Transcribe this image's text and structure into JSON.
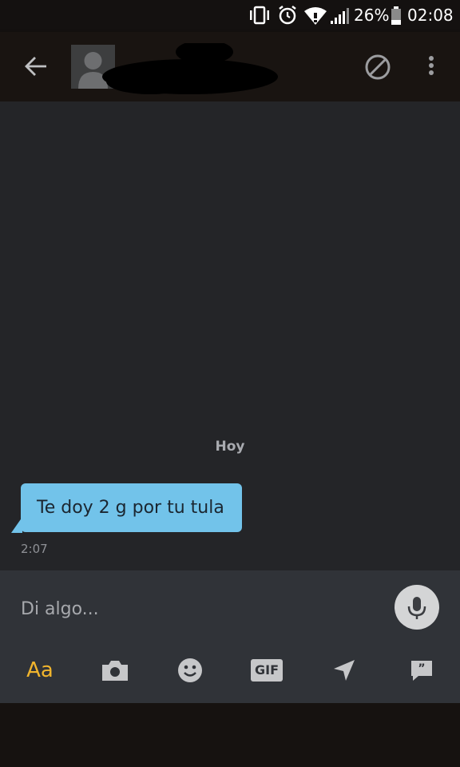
{
  "status_bar": {
    "battery_percent": "26%",
    "time": "02:08",
    "icons": [
      "vibrate-icon",
      "alarm-icon",
      "wifi-icon",
      "signal-icon",
      "battery-icon"
    ]
  },
  "app_bar": {
    "icons": [
      "back-arrow-icon",
      "avatar-placeholder-icon",
      "block-icon",
      "more-vert-icon"
    ]
  },
  "chat": {
    "day_label": "Hoy",
    "messages": [
      {
        "text": "Te doy 2 g por tu tula",
        "time": "2:07"
      }
    ]
  },
  "composer": {
    "placeholder": "Di algo...",
    "mic_icon": "microphone-icon",
    "tools": [
      {
        "name": "font",
        "label": "Aa"
      },
      {
        "name": "camera",
        "icon": "camera-icon"
      },
      {
        "name": "emoji",
        "icon": "smiley-icon"
      },
      {
        "name": "gif",
        "label": "GIF"
      },
      {
        "name": "location",
        "icon": "send-location-icon"
      },
      {
        "name": "phrases",
        "icon": "quote-bubble-icon"
      }
    ]
  },
  "colors": {
    "chat_background": "#242528",
    "bubble": "#72c3ea",
    "accent": "#f1b52d",
    "composer": "#303338",
    "app_bar": "#191411"
  }
}
